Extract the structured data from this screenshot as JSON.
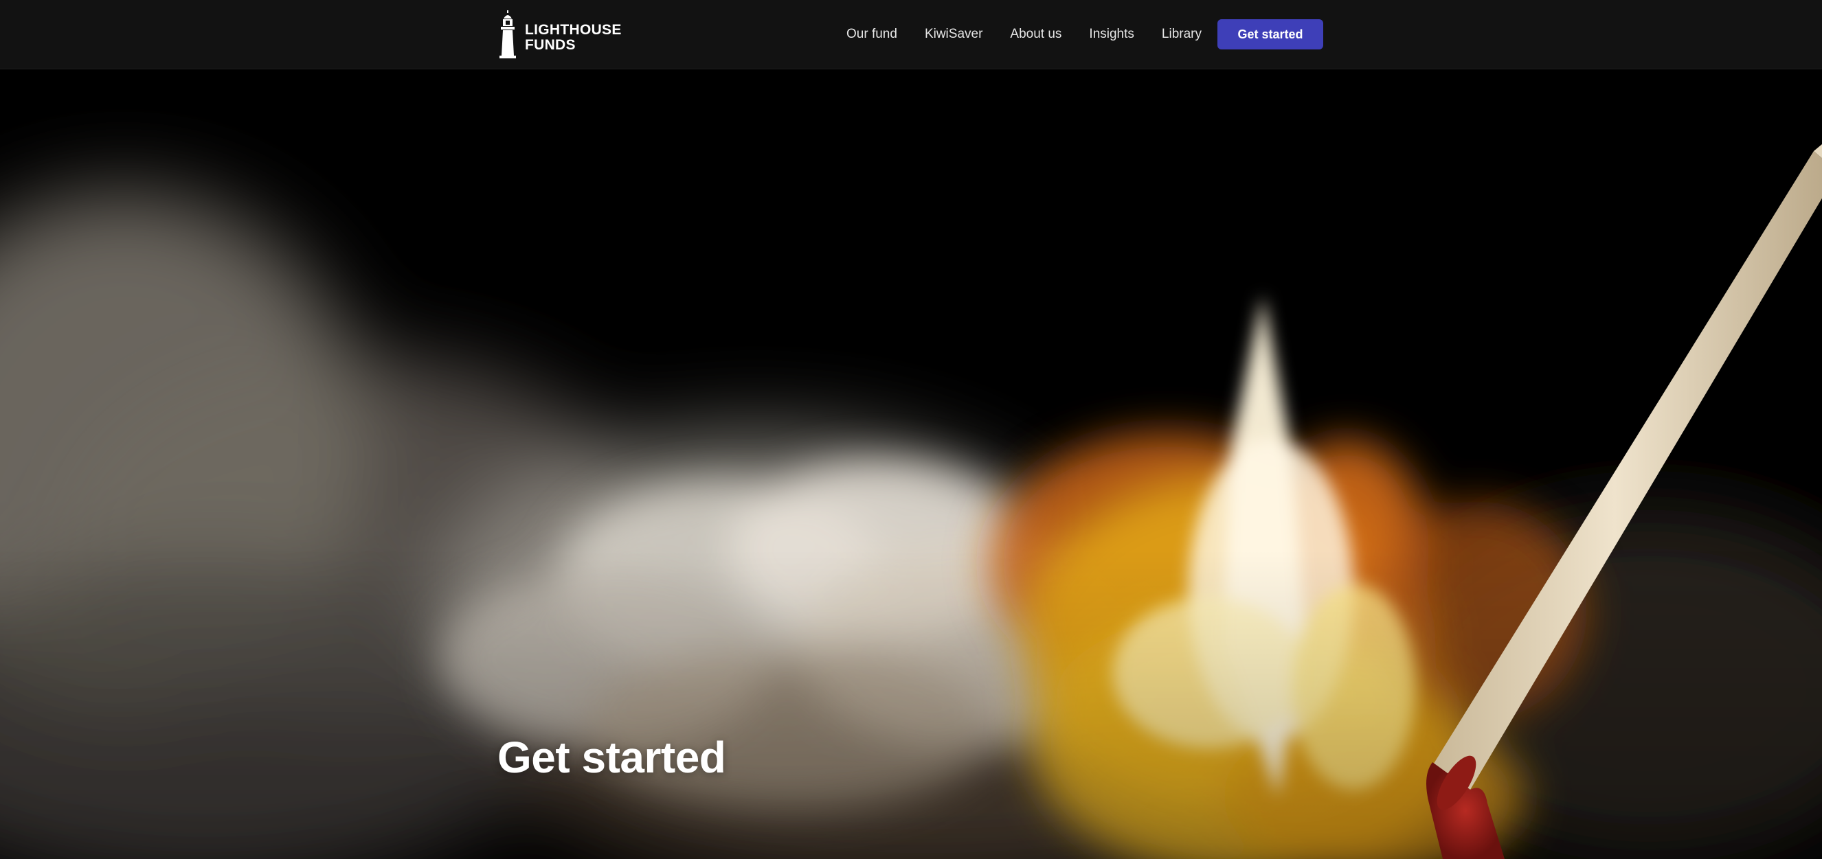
{
  "header": {
    "logo": {
      "line1": "LIGHTHOUSE",
      "line2": "FUNDS",
      "icon": "lighthouse-icon"
    },
    "nav": [
      {
        "label": "Our fund"
      },
      {
        "label": "KiwiSaver"
      },
      {
        "label": "About us"
      },
      {
        "label": "Insights"
      },
      {
        "label": "Library"
      }
    ],
    "cta_label": "Get started"
  },
  "hero": {
    "title": "Get started",
    "image": "match-igniting-in-smoke"
  },
  "colors": {
    "header_bg": "#121212",
    "cta_bg": "#3e3fb8",
    "text": "#ffffff",
    "page_bg": "#000000"
  }
}
